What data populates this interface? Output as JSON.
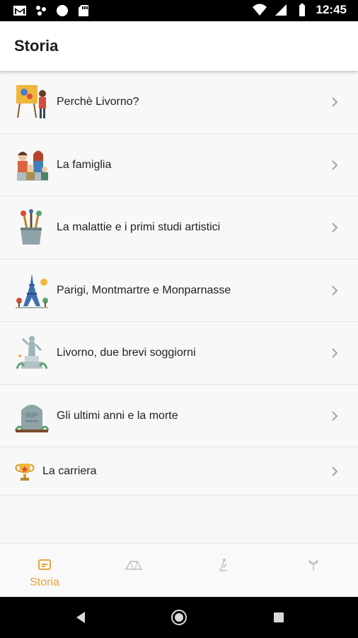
{
  "status_bar": {
    "time": "12:45",
    "icons": [
      "gmail-icon",
      "photos-icon",
      "circle-icon",
      "sd-card-icon",
      "wifi-icon",
      "signal-icon",
      "battery-icon"
    ]
  },
  "app_bar": {
    "title": "Storia"
  },
  "list": {
    "items": [
      {
        "label": "Perchè Livorno?",
        "icon": "painter-easel-icon"
      },
      {
        "label": "La famiglia",
        "icon": "family-icon"
      },
      {
        "label": "La malattie e i primi studi artistici",
        "icon": "paint-brushes-cup-icon"
      },
      {
        "label": "Parigi, Montmartre e Monparnasse",
        "icon": "eiffel-tower-icon"
      },
      {
        "label": "Livorno, due brevi soggiorni",
        "icon": "statue-icon"
      },
      {
        "label": "Gli ultimi anni e la morte",
        "icon": "rip-tombstone-icon"
      },
      {
        "label": "La carriera",
        "icon": "trophy-icon"
      }
    ]
  },
  "bottom_nav": {
    "items": [
      {
        "label": "Storia",
        "icon": "history-icon",
        "active": true
      },
      {
        "label": "",
        "icon": "map-icon",
        "active": false
      },
      {
        "label": "",
        "icon": "sculpture-icon",
        "active": false
      },
      {
        "label": "",
        "icon": "leaves-icon",
        "active": false
      }
    ]
  },
  "colors": {
    "accent": "#e8a43b",
    "chevron": "#9aa9a4",
    "inactive_icon": "#b9c4c0"
  }
}
